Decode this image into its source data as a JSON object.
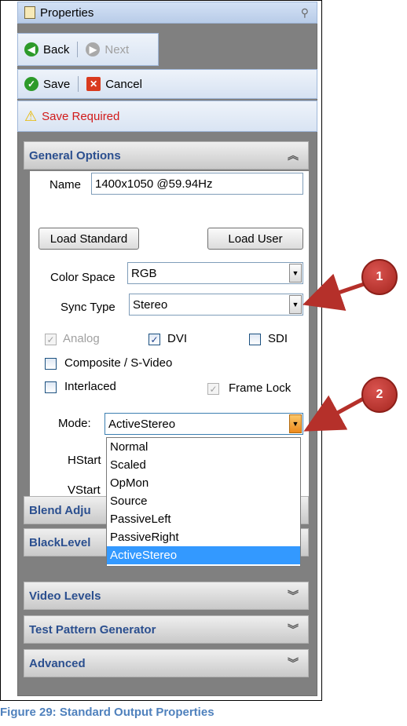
{
  "window": {
    "title": "Properties"
  },
  "nav": {
    "back_label": "Back",
    "next_label": "Next"
  },
  "actions": {
    "save_label": "Save",
    "cancel_label": "Cancel"
  },
  "status": {
    "save_required": "Save Required"
  },
  "general_options": {
    "header": "General Options",
    "name_label": "Name",
    "name_value": "1400x1050 @59.94Hz",
    "load_standard_label": "Load Standard",
    "load_user_label": "Load User",
    "color_space_label": "Color Space",
    "color_space_value": "RGB",
    "sync_type_label": "Sync Type",
    "sync_type_value": "Stereo",
    "analog_label": "Analog",
    "dvi_label": "DVI",
    "sdi_label": "SDI",
    "composite_label": "Composite / S-Video",
    "interlaced_label": "Interlaced",
    "frame_lock_label": "Frame Lock",
    "mode_label": "Mode:",
    "mode_value": "ActiveStereo",
    "hstart_label": "HStart",
    "vstart_label": "VStart",
    "mode_options": [
      "Normal",
      "Scaled",
      "OpMon",
      "Source",
      "PassiveLeft",
      "PassiveRight",
      "ActiveStereo"
    ],
    "checkboxes": {
      "analog": true,
      "dvi": true,
      "sdi": false,
      "composite": false,
      "interlaced": false,
      "frame_lock": true
    }
  },
  "sections": {
    "blend": "Blend Adju",
    "blacklevel": "BlackLevel",
    "video_levels": "Video Levels",
    "test_pattern": "Test Pattern Generator",
    "advanced": "Advanced"
  },
  "callouts": {
    "one": "1",
    "two": "2"
  },
  "caption": "Figure 29: Standard Output Properties",
  "colors": {
    "accent": "#2b4f8f",
    "warning": "#d21a1a",
    "selection": "#3399ff",
    "callout": "#b5302a"
  }
}
